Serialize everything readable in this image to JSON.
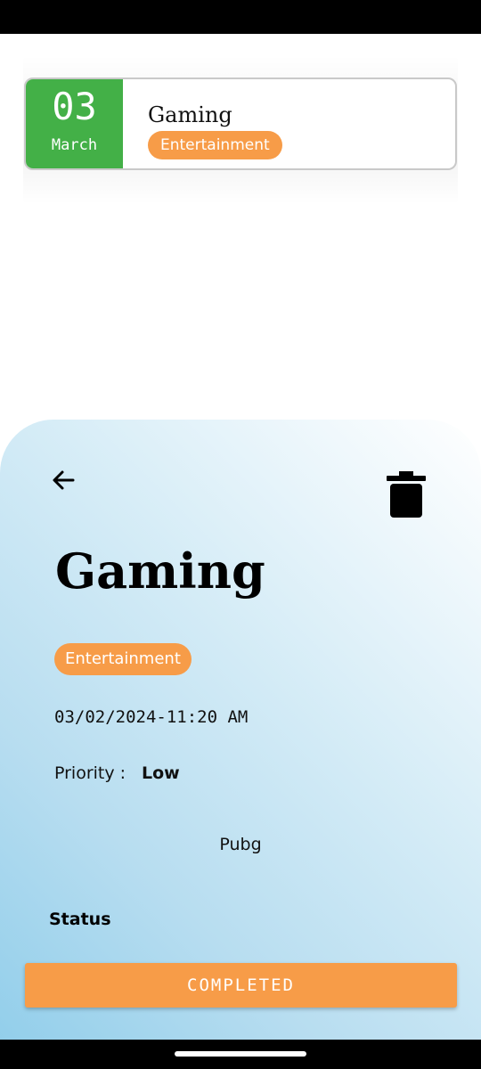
{
  "task_card": {
    "day": "03",
    "month": "March",
    "title": "Gaming",
    "category": "Entertainment",
    "date_color": "#43B047",
    "chip_color": "#F79C48"
  },
  "detail": {
    "back_icon": "arrow-left-icon",
    "delete_icon": "trash-icon",
    "title": "Gaming",
    "category": "Entertainment",
    "datetime": "03/02/2024-11:20 AM",
    "priority_label": "Priority :",
    "priority_value": "Low",
    "description": "Pubg",
    "status_label": "Status",
    "button_label": "COMPLETED",
    "button_color": "#F79C48"
  }
}
